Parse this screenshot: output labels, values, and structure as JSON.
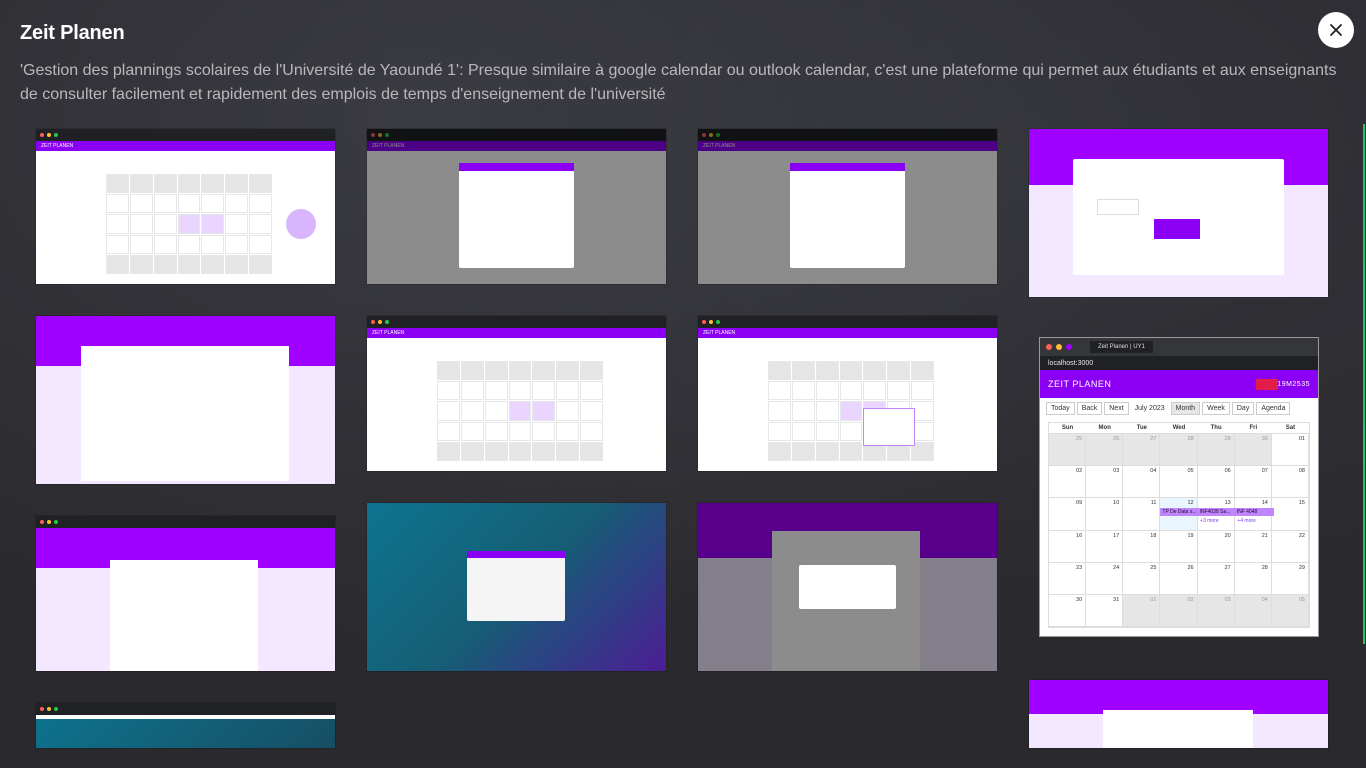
{
  "modal": {
    "title": "Zeit Planen",
    "description": "'Gestion des plannings scolaires de l'Université de Yaoundé 1': Presque similaire à google calendar ou outlook calendar, c'est une plateforme qui permet aux étudiants et aux enseignants de consulter facilement et rapidement des emplois de temps d'enseignement de l'université",
    "close_icon": "close-icon"
  },
  "colors": {
    "accent": "#8b00f5",
    "background": "#27272a",
    "danger": "#e11d48"
  },
  "gallery": {
    "thumbnails": [
      {
        "kind": "calendar"
      },
      {
        "kind": "calendar-modal"
      },
      {
        "kind": "calendar-modal"
      },
      {
        "kind": "dashboard"
      },
      {
        "kind": "specialites"
      },
      {
        "kind": "calendar"
      },
      {
        "kind": "calendar-popover"
      },
      {
        "kind": "profile"
      },
      {
        "kind": "login"
      },
      {
        "kind": "profile-dialog"
      },
      {
        "kind": "desktop"
      },
      {
        "kind": "profile"
      }
    ],
    "featured": {
      "tab_title": "Zeit Planen | UY1",
      "url": "localhost:3000",
      "app_name": "ZEIT PLANEN",
      "user_id": "19M2535",
      "toolbar": {
        "today": "Today",
        "back": "Back",
        "next": "Next",
        "month_label": "July 2023",
        "views": [
          "Month",
          "Week",
          "Day",
          "Agenda"
        ],
        "active_view": "Month"
      },
      "weekdays": [
        "Sun",
        "Mon",
        "Tue",
        "Wed",
        "Thu",
        "Fri",
        "Sat"
      ],
      "weeks": [
        [
          "25",
          "26",
          "27",
          "28",
          "29",
          "30",
          "01"
        ],
        [
          "02",
          "03",
          "04",
          "05",
          "06",
          "07",
          "08"
        ],
        [
          "09",
          "10",
          "11",
          "12",
          "13",
          "14",
          "15"
        ],
        [
          "16",
          "17",
          "18",
          "19",
          "20",
          "21",
          "22"
        ],
        [
          "23",
          "24",
          "25",
          "26",
          "27",
          "28",
          "29"
        ],
        [
          "30",
          "31",
          "01",
          "02",
          "03",
          "04",
          "05"
        ]
      ],
      "events": [
        {
          "label": "TP De Data s..."
        },
        {
          "label": "INF4038 Sa..."
        },
        {
          "label": "INF 4048"
        }
      ],
      "more_links": [
        "+3 more",
        "+4 more"
      ]
    }
  }
}
